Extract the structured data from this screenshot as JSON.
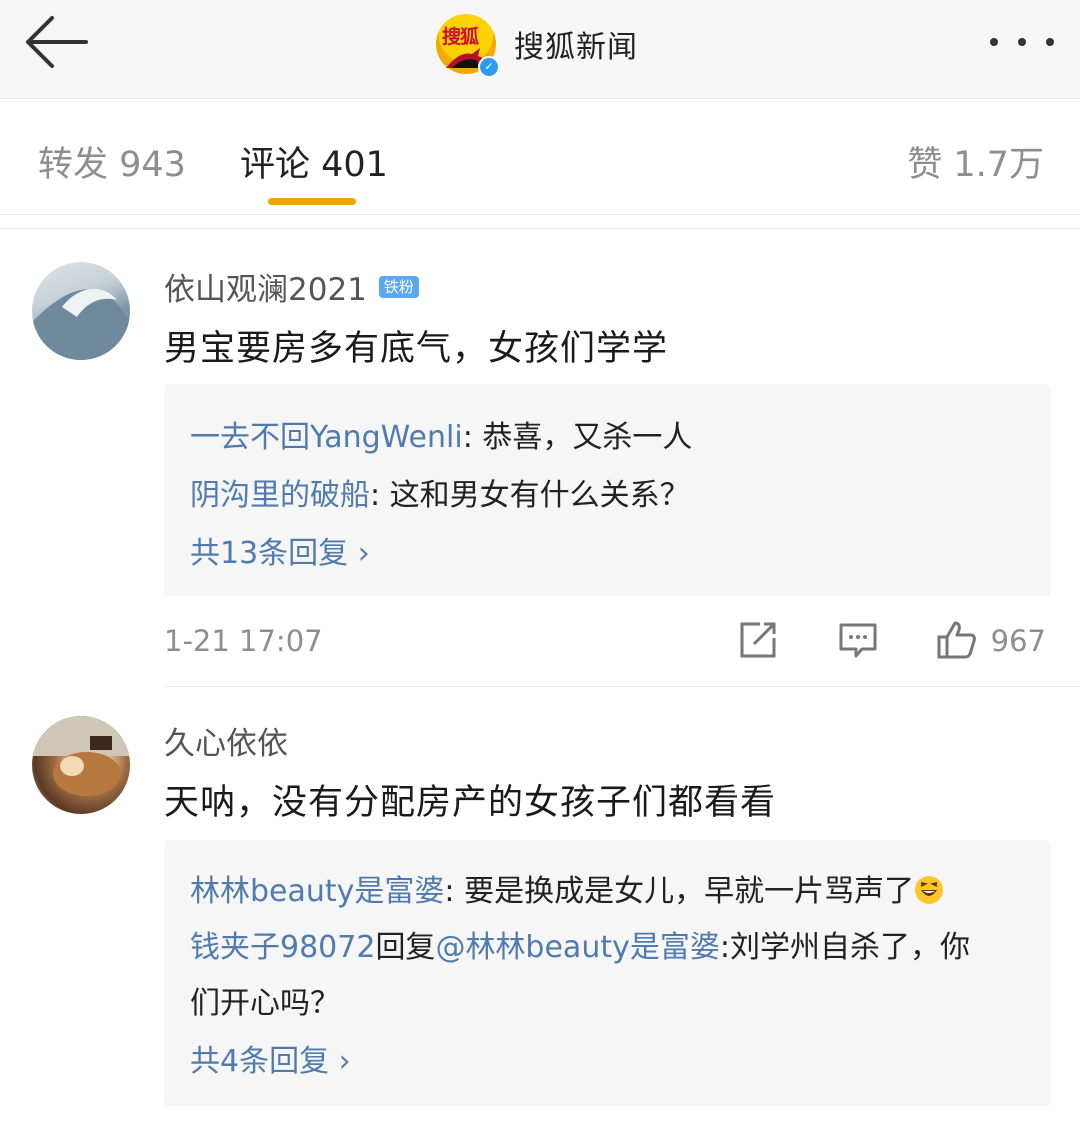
{
  "header": {
    "account_name": "搜狐新闻",
    "logo_text": "搜狐"
  },
  "tabs": {
    "repost": "转发 943",
    "comments": "评论 401",
    "likes": "赞 1.7万"
  },
  "comments": [
    {
      "username": "依山观澜2021",
      "badge": "铁粉",
      "text": "男宝要房多有底气，女孩们学学",
      "replies": [
        {
          "user": "一去不回YangWenli",
          "text": ": 恭喜，又杀一人"
        },
        {
          "user": "阴沟里的破船",
          "text": ": 这和男女有什么关系？"
        }
      ],
      "more_replies": "共13条回复 ›",
      "timestamp": "1-21 17:07",
      "likes": "967"
    },
    {
      "username": "久心依依",
      "text": "天呐，没有分配房产的女孩子们都看看",
      "replies": [
        {
          "user": "林林beauty是富婆",
          "text": ": 要是换成是女儿，早就一片骂声了"
        },
        {
          "user": "钱夹子98072",
          "mid": "回复",
          "mention": "@林林beauty是富婆",
          "text": ":刘学州自杀了，你",
          "text2": "们开心吗？"
        }
      ],
      "more_replies": "共4条回复 ›"
    }
  ],
  "icons": [
    "back-arrow-icon",
    "more-dots-icon",
    "repost-icon",
    "comment-icon",
    "thumbs-up-icon",
    "laughing-emoji-icon"
  ],
  "colors": {
    "accent": "#f4a30b",
    "link": "#4f7bb0",
    "badge": "#5aa7f2"
  }
}
